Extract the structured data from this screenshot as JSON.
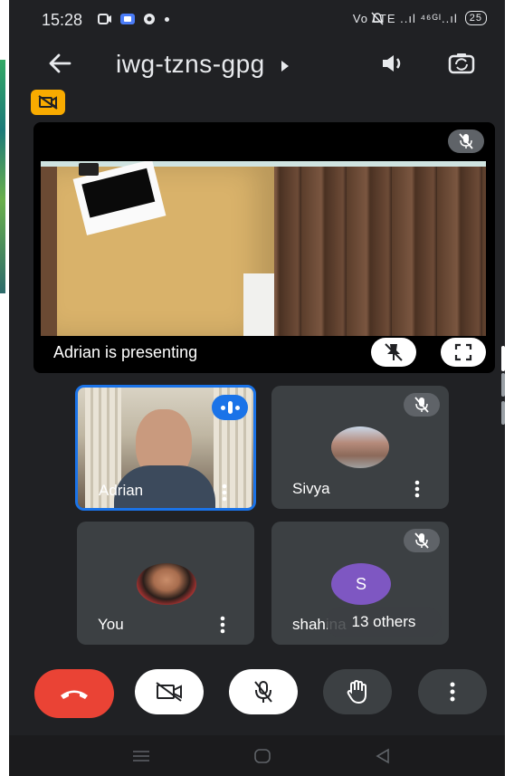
{
  "status_bar": {
    "time": "15:28",
    "right_text": "Vo LTE ..ıl ⁴⁶ᴳᴵ..ıl",
    "battery": "25"
  },
  "header": {
    "meeting_code": "iwg-tzns-gpg"
  },
  "presentation": {
    "label": "Adrian is presenting"
  },
  "participants": [
    {
      "name": "Adrian",
      "speaking": true
    },
    {
      "name": "Sivya"
    },
    {
      "name": "You"
    },
    {
      "name": "shahina",
      "avatar_letter": "S",
      "overlay": "13 others"
    }
  ],
  "colors": {
    "leave": "#ea4335",
    "speaking": "#1a73e8",
    "avatar_s": "#7e57c2",
    "camera_off_badge": "#f9ab00"
  }
}
